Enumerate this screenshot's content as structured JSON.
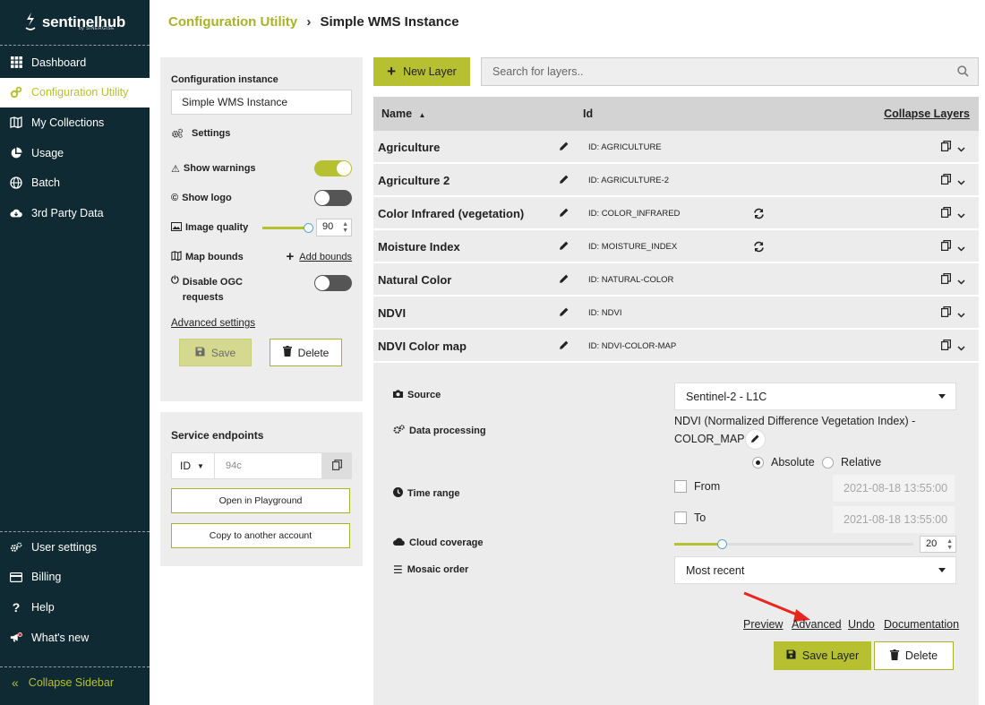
{
  "sidebar": {
    "brand": "sentinelhub",
    "brand_sub": "by SINERGISE",
    "items": [
      {
        "label": "Dashboard",
        "icon": "grid-icon"
      },
      {
        "label": "Configuration Utility",
        "icon": "configuration-icon"
      },
      {
        "label": "My Collections",
        "icon": "map-icon"
      },
      {
        "label": "Usage",
        "icon": "pie-chart-icon"
      },
      {
        "label": "Batch",
        "icon": "globe-icon"
      },
      {
        "label": "3rd Party Data",
        "icon": "cloud-download-icon"
      }
    ],
    "bottom_items": [
      {
        "label": "User settings",
        "icon": "user-settings-icon"
      },
      {
        "label": "Billing",
        "icon": "credit-card-icon"
      },
      {
        "label": "Help",
        "icon": "question-icon"
      },
      {
        "label": "What's new",
        "icon": "megaphone-icon"
      }
    ],
    "collapse": "Collapse Sidebar"
  },
  "breadcrumb": {
    "parent": "Configuration Utility",
    "separator": "›",
    "current": "Simple WMS Instance"
  },
  "config": {
    "instance_label": "Configuration instance",
    "instance_value": "Simple WMS Instance",
    "settings_title": "Settings",
    "show_warnings": "Show warnings",
    "show_logo": "Show logo",
    "image_quality": "Image quality",
    "image_quality_value": "90",
    "image_quality_fraction": 0.9,
    "map_bounds": "Map bounds",
    "add_bounds": "Add bounds",
    "disable_ogc": "Disable OGC requests",
    "advanced_settings": "Advanced settings",
    "save": "Save",
    "delete": "Delete",
    "toggles": {
      "show_warnings": true,
      "show_logo": false,
      "disable_ogc": false
    }
  },
  "endpoints": {
    "title": "Service endpoints",
    "id_select": "ID",
    "id_value": "94c",
    "open_playground": "Open in Playground",
    "copy_account": "Copy to another account"
  },
  "toolbar": {
    "new_layer": "New Layer",
    "search_placeholder": "Search for layers.."
  },
  "layers": {
    "col_name": "Name",
    "col_id": "Id",
    "collapse_layers": "Collapse Layers",
    "rows": [
      {
        "name": "Agriculture",
        "id": "ID: AGRICULTURE",
        "refresh": false
      },
      {
        "name": "Agriculture 2",
        "id": "ID: AGRICULTURE-2",
        "refresh": false
      },
      {
        "name": "Color Infrared (vegetation)",
        "id": "ID: COLOR_INFRARED",
        "refresh": true
      },
      {
        "name": "Moisture Index",
        "id": "ID: MOISTURE_INDEX",
        "refresh": true
      },
      {
        "name": "Natural Color",
        "id": "ID: NATURAL-COLOR",
        "refresh": false
      },
      {
        "name": "NDVI",
        "id": "ID: NDVI",
        "refresh": false
      },
      {
        "name": "NDVI Color map",
        "id": "ID: NDVI-COLOR-MAP",
        "refresh": false
      }
    ]
  },
  "details": {
    "source_label": "Source",
    "source_value": "Sentinel-2 - L1C",
    "data_processing_label": "Data processing",
    "data_processing_line1": "NDVI (Normalized Difference Vegetation Index) -",
    "data_processing_line2": "COLOR_MAP",
    "time_range_label": "Time range",
    "absolute": "Absolute",
    "relative": "Relative",
    "from": "From",
    "to": "To",
    "from_date": "2021-08-18 13:55:00",
    "to_date": "2021-08-18 13:55:00",
    "cloud_coverage_label": "Cloud coverage",
    "cloud_coverage_value": "20",
    "cloud_coverage_fraction": 0.2,
    "mosaic_order_label": "Mosaic order",
    "mosaic_order_value": "Most recent",
    "preview": "Preview",
    "advanced": "Advanced",
    "undo": "Undo",
    "documentation": "Documentation",
    "save_layer": "Save Layer",
    "delete": "Delete"
  },
  "colors": {
    "accent": "#b6c031",
    "sidebar_bg": "#0f2a33",
    "annotation_arrow": "#e8261d"
  }
}
